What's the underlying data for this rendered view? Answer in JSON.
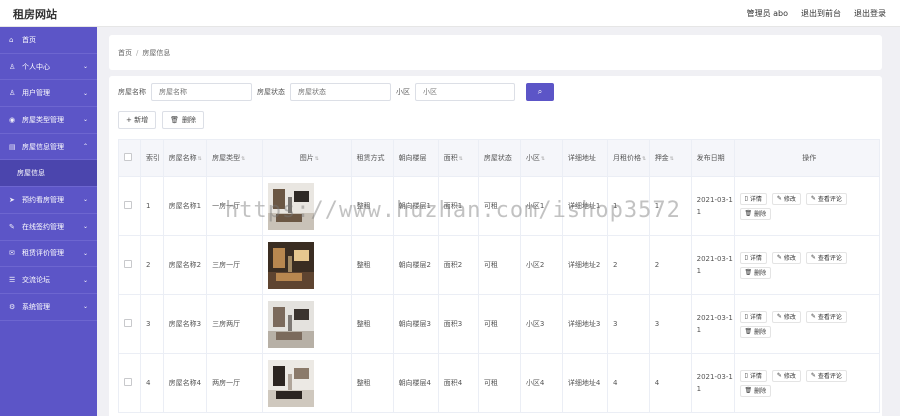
{
  "app": {
    "title": "租房网站"
  },
  "topbar": {
    "user": "管理员 abo",
    "front": "退出到前台",
    "logout": "退出登录"
  },
  "sidebar": {
    "items": [
      {
        "label": "首页",
        "icon": "home-icon",
        "chev": ""
      },
      {
        "label": "个人中心",
        "icon": "user-icon",
        "chev": "⌄"
      },
      {
        "label": "用户管理",
        "icon": "users-icon",
        "chev": "⌄"
      },
      {
        "label": "房屋类型管理",
        "icon": "location-icon",
        "chev": "⌄"
      },
      {
        "label": "房屋信息管理",
        "icon": "house-icon",
        "chev": "⌃"
      },
      {
        "label": "房屋信息",
        "icon": "",
        "chev": ""
      },
      {
        "label": "预约看房管理",
        "icon": "send-icon",
        "chev": "⌄"
      },
      {
        "label": "在线签约管理",
        "icon": "sign-icon",
        "chev": "⌄"
      },
      {
        "label": "租赁评价管理",
        "icon": "comment-icon",
        "chev": "⌄"
      },
      {
        "label": "交流论坛",
        "icon": "forum-icon",
        "chev": "⌄"
      },
      {
        "label": "系统管理",
        "icon": "system-icon",
        "chev": "⌄"
      }
    ]
  },
  "breadcrumb": {
    "home": "首页",
    "sep": "/",
    "current": "房屋信息"
  },
  "search": {
    "name_label": "房屋名称",
    "name_placeholder": "房屋名称",
    "status_label": "房屋状态",
    "status_placeholder": "房屋状态",
    "area_label": "小区",
    "area_placeholder": "小区",
    "button_icon": "search-icon"
  },
  "toolbar": {
    "add_label": "+ 新增",
    "delete_label": "删除"
  },
  "table": {
    "headers": [
      "索引",
      "房屋名称",
      "房屋类型",
      "图片",
      "租赁方式",
      "朝向楼层",
      "面积",
      "房屋状态",
      "小区",
      "详细地址",
      "月租价格",
      "押金",
      "发布日期",
      "操作"
    ],
    "rows": [
      {
        "index": "1",
        "name": "房屋名称1",
        "type": "一房一厅",
        "mode": "整租",
        "floor": "朝向楼层1",
        "size": "面积1",
        "status": "可租",
        "area": "小区1",
        "address": "详细地址1",
        "rent": "1",
        "deposit": "1",
        "date": "2021-03-11"
      },
      {
        "index": "2",
        "name": "房屋名称2",
        "type": "三房一厅",
        "mode": "整租",
        "floor": "朝向楼层2",
        "size": "面积2",
        "status": "可租",
        "area": "小区2",
        "address": "详细地址2",
        "rent": "2",
        "deposit": "2",
        "date": "2021-03-11"
      },
      {
        "index": "3",
        "name": "房屋名称3",
        "type": "三房两厅",
        "mode": "整租",
        "floor": "朝向楼层3",
        "size": "面积3",
        "status": "可租",
        "area": "小区3",
        "address": "详细地址3",
        "rent": "3",
        "deposit": "3",
        "date": "2021-03-11"
      },
      {
        "index": "4",
        "name": "房屋名称4",
        "type": "两房一厅",
        "mode": "整租",
        "floor": "朝向楼层4",
        "size": "面积4",
        "status": "可租",
        "area": "小区4",
        "address": "详细地址4",
        "rent": "4",
        "deposit": "4",
        "date": "2021-03-11"
      }
    ],
    "ops": {
      "detail": "详情",
      "edit": "修改",
      "review": "查看评论",
      "delete": "删除"
    }
  },
  "watermark": "https://www.huzhan.com/ishop3572",
  "colors": {
    "accent": "#5c55c7",
    "sidebar_sub": "#4b45ad"
  }
}
